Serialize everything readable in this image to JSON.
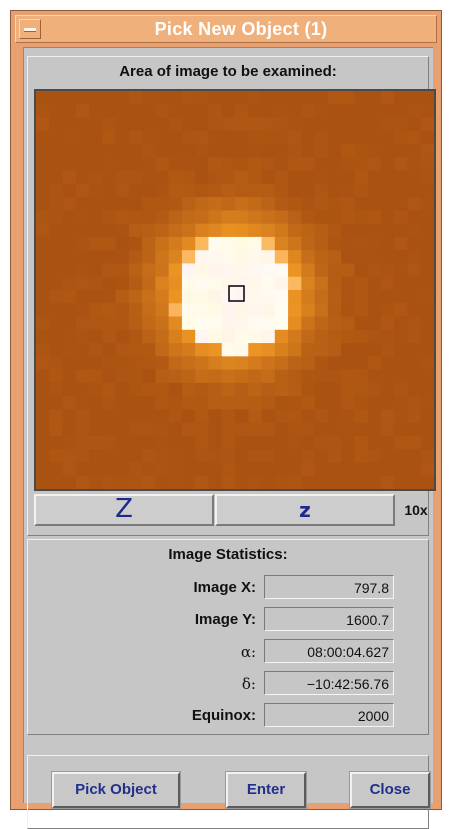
{
  "window": {
    "title": "Pick New Object (1)"
  },
  "viewer": {
    "label": "Area of image to be examined:",
    "zoom_out_label": "Z",
    "zoom_in_label": "z",
    "zoom_level": "10x"
  },
  "stats": {
    "heading": "Image Statistics:",
    "rows": [
      {
        "label": "Image X:",
        "value": "797.8"
      },
      {
        "label": "Image Y:",
        "value": "1600.7"
      },
      {
        "label": "α:",
        "value": "08:00:04.627"
      },
      {
        "label": "δ:",
        "value": "−10:42:56.76"
      },
      {
        "label": "Equinox:",
        "value": "2000"
      }
    ]
  },
  "buttons": {
    "pick": "Pick Object",
    "enter": "Enter",
    "close": "Close"
  },
  "colors": {
    "title_bar": "#f0b07c",
    "background": "#c6c6c6",
    "button_text": "#22308a",
    "star_core": "#ffffff",
    "star_halo": "#f08a20",
    "sky_background": "#a84a10"
  }
}
